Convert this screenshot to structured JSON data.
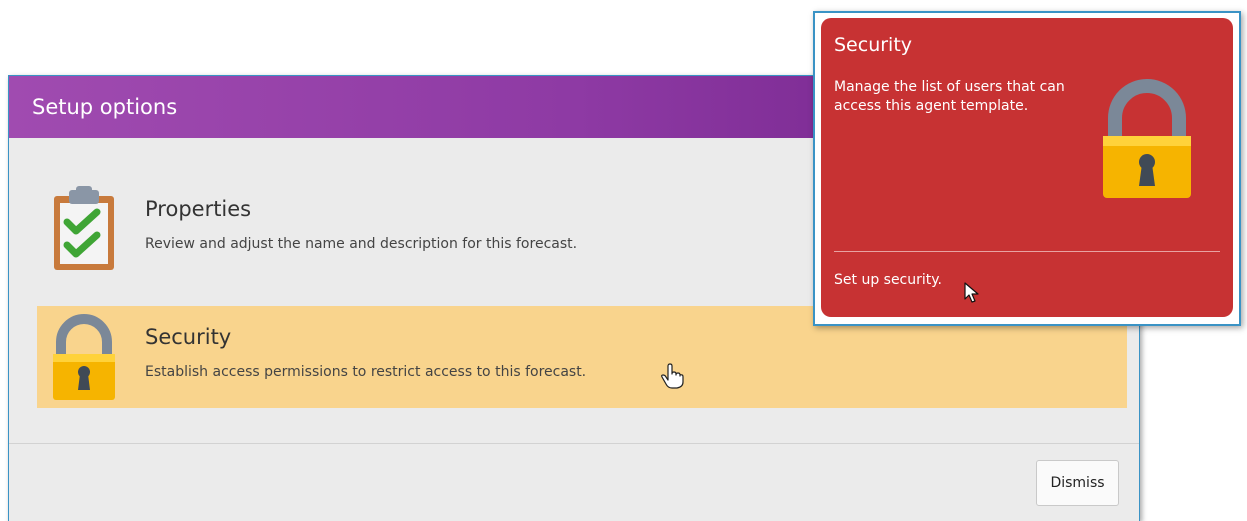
{
  "dialog": {
    "title": "Setup options",
    "options": [
      {
        "title": "Properties",
        "description": "Review and adjust the name and description for this forecast.",
        "icon": "clipboard-check-icon"
      },
      {
        "title": "Security",
        "description": "Establish access permissions to restrict access to this forecast.",
        "icon": "lock-icon"
      }
    ],
    "dismiss_label": "Dismiss"
  },
  "tooltip": {
    "title": "Security",
    "description": "Manage the list of users that can access this agent template.",
    "link_label": "Set up security.",
    "icon": "lock-icon"
  },
  "colors": {
    "title_gradient_start": "#a04bb0",
    "title_gradient_end": "#6e1f86",
    "hover_background": "#f9d48d",
    "tooltip_background": "#c73233",
    "border_accent": "#3a93c5"
  }
}
